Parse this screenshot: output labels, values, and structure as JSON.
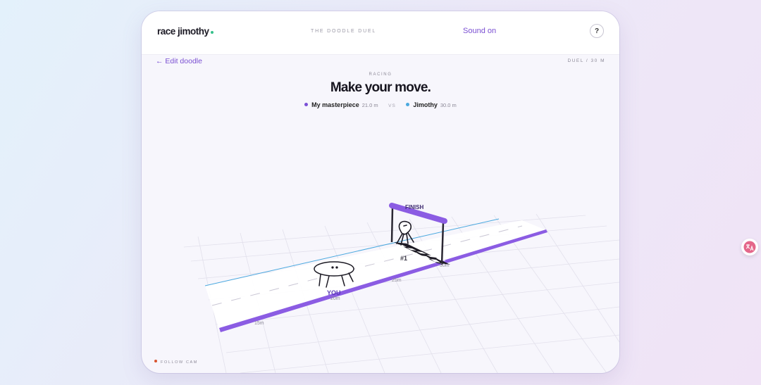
{
  "app": {
    "brand": "race jimothy",
    "subtitle": "THE DOODLE DUEL",
    "sound_label": "Sound on",
    "help_label": "?"
  },
  "nav": {
    "edit_label": "← Edit doodle",
    "duel_info": "DUEL / 30 M"
  },
  "race": {
    "status": "RACING",
    "headline": "Make your move.",
    "vs_label": "VS",
    "racers": [
      {
        "name": "My masterpiece",
        "distance": "21.0 m",
        "color": "#7b4fd6"
      },
      {
        "name": "Jimothy",
        "distance": "30.0 m",
        "color": "#4ba9df"
      }
    ]
  },
  "track": {
    "finish_label": "FINISH",
    "you_label": "YOU",
    "rank_label": "#1",
    "markers": [
      "15m",
      "20m",
      "25m",
      "30m"
    ]
  },
  "camera": {
    "follow_label": "FOLLOW CAM"
  },
  "colors": {
    "accent": "#7b4fd6",
    "jimothy": "#4ba9df",
    "brand_dot": "#36c08b",
    "rec": "#d9542f"
  },
  "icons": {
    "translate": "translate-icon"
  }
}
